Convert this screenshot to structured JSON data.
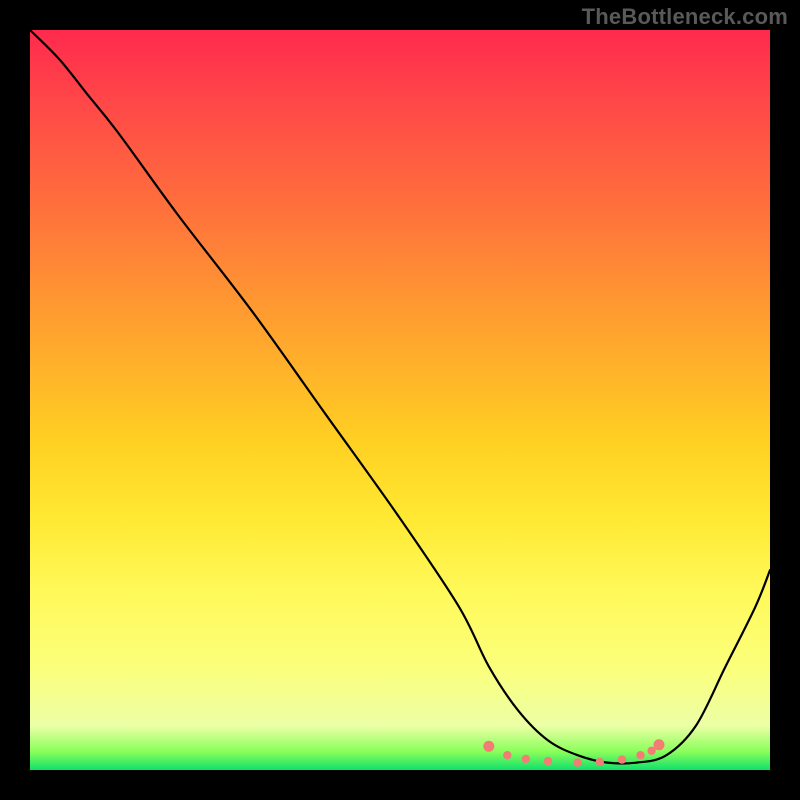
{
  "watermark": "TheBottleneck.com",
  "chart_data": {
    "type": "line",
    "title": "",
    "xlabel": "",
    "ylabel": "",
    "xlim": [
      0,
      100
    ],
    "ylim": [
      0,
      100
    ],
    "series": [
      {
        "name": "curve",
        "x": [
          0,
          4,
          8,
          12,
          20,
          30,
          40,
          50,
          58,
          62,
          66,
          70,
          74,
          78,
          82,
          86,
          90,
          94,
          98,
          100
        ],
        "y": [
          100,
          96,
          91,
          86,
          75,
          62,
          48,
          34,
          22,
          14,
          8,
          4,
          2,
          1,
          1,
          2,
          6,
          14,
          22,
          27
        ]
      }
    ],
    "markers": {
      "name": "trough-dots",
      "color": "#f37c74",
      "x": [
        62,
        64.5,
        67,
        70,
        74,
        77,
        80,
        82.5,
        84,
        85
      ],
      "y": [
        3.2,
        2.0,
        1.5,
        1.2,
        1.0,
        1.1,
        1.4,
        2.0,
        2.6,
        3.4
      ]
    },
    "gradient_stops": [
      {
        "pos": 0,
        "color": "#ff2a4d"
      },
      {
        "pos": 0.1,
        "color": "#ff4848"
      },
      {
        "pos": 0.22,
        "color": "#ff6a3e"
      },
      {
        "pos": 0.34,
        "color": "#ff8f34"
      },
      {
        "pos": 0.46,
        "color": "#ffb32a"
      },
      {
        "pos": 0.56,
        "color": "#ffd122"
      },
      {
        "pos": 0.66,
        "color": "#ffe933"
      },
      {
        "pos": 0.76,
        "color": "#fff95a"
      },
      {
        "pos": 0.86,
        "color": "#fbff7a"
      },
      {
        "pos": 0.94,
        "color": "#ecffa5"
      },
      {
        "pos": 0.975,
        "color": "#8aff5a"
      },
      {
        "pos": 1.0,
        "color": "#10e06a"
      }
    ]
  }
}
